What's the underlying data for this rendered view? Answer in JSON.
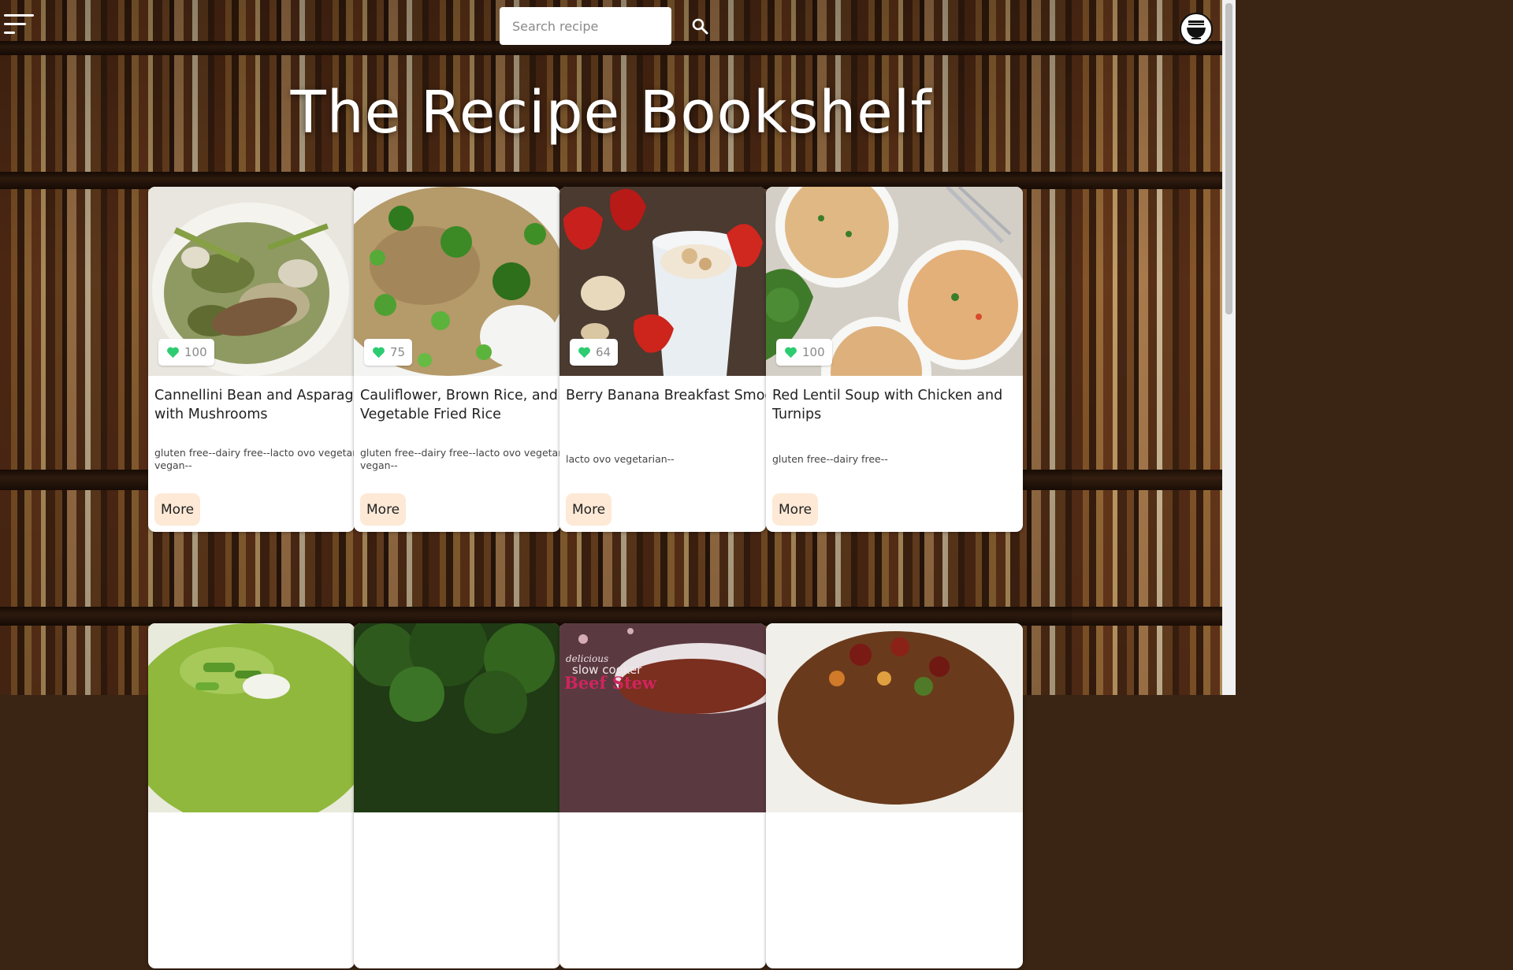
{
  "header": {
    "search_placeholder": "Search recipe",
    "title": "The Recipe Bookshelf"
  },
  "colors": {
    "accent_heart": "#2ecc71",
    "more_button_bg": "#fde9d6",
    "card_bg": "#ffffff"
  },
  "recipes": [
    {
      "likes": "100",
      "name_line1": "Cannellini Bean and Asparagus",
      "name_line2": "with Mushrooms",
      "diets_line1": "gluten free--dairy free--lacto ovo vegetarian--",
      "diets_line2": "vegan--",
      "more_label": "More"
    },
    {
      "likes": "75",
      "name_line1": "Cauliflower, Brown Rice, and",
      "name_line2": "Vegetable Fried Rice",
      "diets_line1": "gluten free--dairy free--lacto ovo vegetarian--",
      "diets_line2": "vegan--",
      "more_label": "More"
    },
    {
      "likes": "64",
      "name_line1": "Berry Banana Breakfast Smoothie",
      "name_line2": "",
      "diets_line1": "lacto ovo vegetarian--",
      "diets_line2": "",
      "more_label": "More"
    },
    {
      "likes": "100",
      "name_line1": "Red Lentil Soup with Chicken and",
      "name_line2": "Turnips",
      "diets_line1": "gluten free--dairy free--",
      "diets_line2": "",
      "more_label": "More"
    }
  ],
  "second_row": {
    "card3_overlay_line1": "delicious",
    "card3_overlay_line2": "slow cooker",
    "card3_overlay_line3": "Beef Stew"
  }
}
